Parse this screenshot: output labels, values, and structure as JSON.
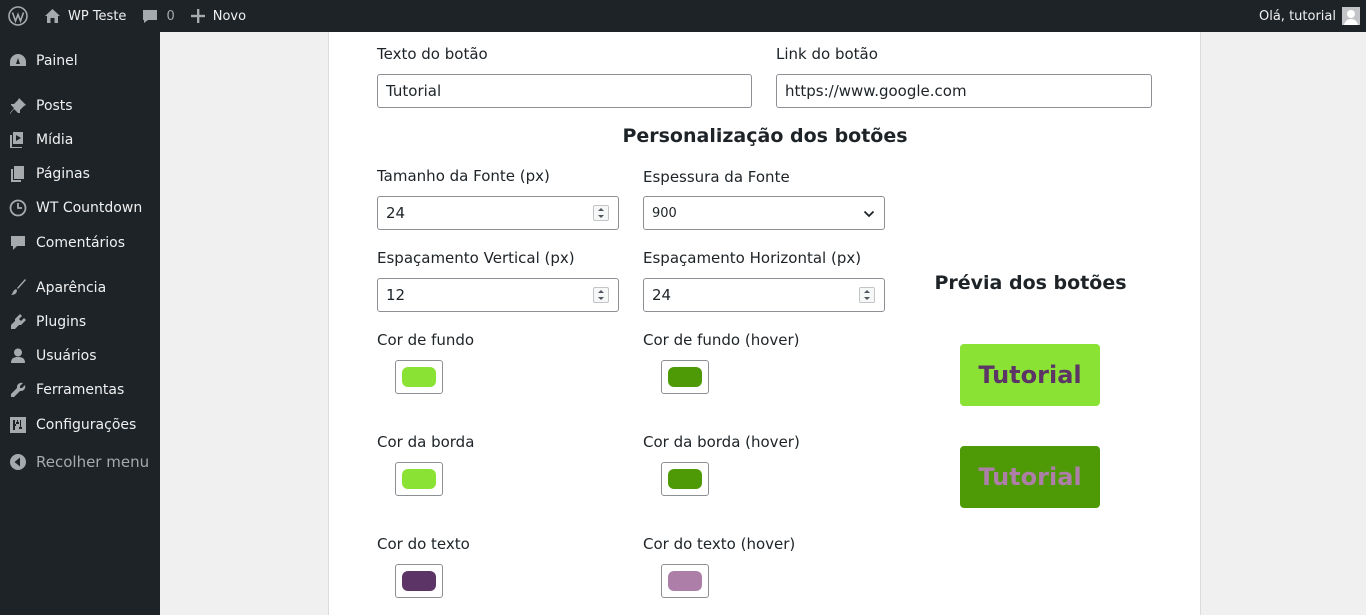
{
  "adminbar": {
    "site_name": "WP Teste",
    "comments_count": "0",
    "new_label": "Novo",
    "greeting": "Olá, tutorial"
  },
  "sidebar": {
    "items": [
      {
        "label": "Painel",
        "icon": "dashboard-icon"
      },
      {
        "label": "Posts",
        "icon": "pin-icon"
      },
      {
        "label": "Mídia",
        "icon": "media-icon"
      },
      {
        "label": "Páginas",
        "icon": "pages-icon"
      },
      {
        "label": "WT Countdown",
        "icon": "clock-icon"
      },
      {
        "label": "Comentários",
        "icon": "comment-icon"
      },
      {
        "label": "Aparência",
        "icon": "brush-icon"
      },
      {
        "label": "Plugins",
        "icon": "plug-icon"
      },
      {
        "label": "Usuários",
        "icon": "user-icon"
      },
      {
        "label": "Ferramentas",
        "icon": "wrench-icon"
      },
      {
        "label": "Configurações",
        "icon": "settings-icon"
      }
    ],
    "collapse_label": "Recolher menu"
  },
  "form": {
    "button_text_label": "Texto do botão",
    "button_text_value": "Tutorial",
    "button_link_label": "Link do botão",
    "button_link_value": "https://www.google.com",
    "section_title": "Personalização dos botões",
    "font_size_label": "Tamanho da Fonte (px)",
    "font_size_value": "24",
    "font_weight_label": "Espessura da Fonte",
    "font_weight_value": "900",
    "vpad_label": "Espaçamento Vertical (px)",
    "vpad_value": "12",
    "hpad_label": "Espaçamento Horizontal (px)",
    "hpad_value": "24",
    "bg_label": "Cor de fundo",
    "bg_hover_label": "Cor de fundo (hover)",
    "border_label": "Cor da borda",
    "border_hover_label": "Cor da borda (hover)",
    "text_label": "Cor do texto",
    "text_hover_label": "Cor do texto (hover)"
  },
  "colors": {
    "bg": "#8ae234",
    "bg_hover": "#4e9a06",
    "border": "#8ae234",
    "border_hover": "#4e9a06",
    "text": "#5c3566",
    "text_hover": "#ad7fa8"
  },
  "preview": {
    "title": "Prévia dos botões",
    "button_label": "Tutorial",
    "hover_button_label": "Tutorial"
  }
}
